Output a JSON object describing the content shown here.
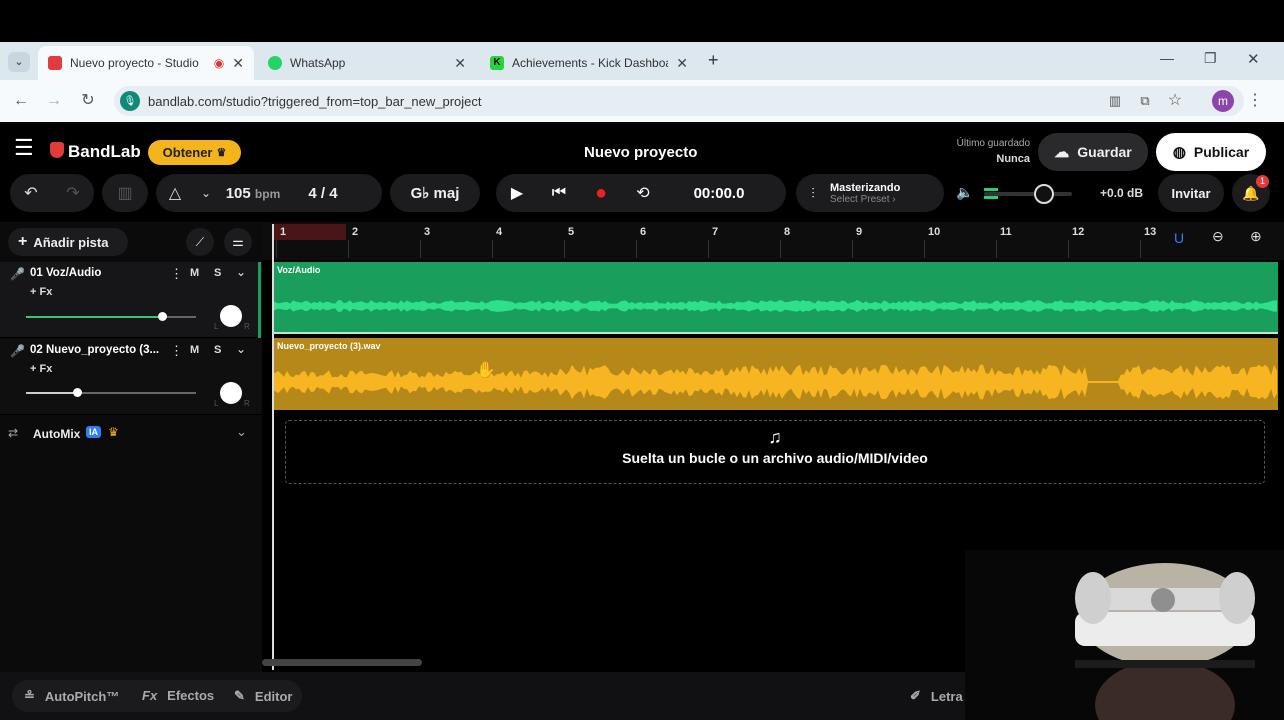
{
  "browser": {
    "tabs": [
      {
        "title": "Nuevo proyecto - Studio",
        "active": true
      },
      {
        "title": "WhatsApp",
        "active": false
      },
      {
        "title": "Achievements - Kick Dashboard",
        "active": false
      }
    ],
    "url": "bandlab.com/studio?triggered_from=top_bar_new_project",
    "profile_initial": "m"
  },
  "app": {
    "brand": "BandLab",
    "get_button": "Obtener",
    "project_title": "Nuevo proyecto",
    "last_saved_label": "Último guardado",
    "last_saved_value": "Nunca",
    "save_button": "Guardar",
    "publish_button": "Publicar"
  },
  "transport": {
    "tempo": "105",
    "tempo_unit": "bpm",
    "time_signature": "4 / 4",
    "key": "G♭ maj",
    "time": "00:00.0",
    "mastering_label": "Masterizando",
    "mastering_preset": "Select Preset ›",
    "volume_db": "+0.0 dB",
    "invite_button": "Invitar",
    "notification_count": "1"
  },
  "tracks_panel": {
    "add_track": "Añadir pista",
    "tracks": [
      {
        "name": "01  Voz/Audio",
        "fx": "+ Fx",
        "mute": "M",
        "solo": "S",
        "volume": 0.8
      },
      {
        "name": "02  Nuevo_proyecto (3...",
        "fx": "+ Fx",
        "mute": "M",
        "solo": "S",
        "volume": 0.3
      }
    ],
    "automix": "AutoMix",
    "automix_badge": "IA"
  },
  "timeline": {
    "ruler": [
      "1",
      "2",
      "3",
      "4",
      "5",
      "6",
      "7",
      "8",
      "9",
      "10",
      "11",
      "12",
      "13"
    ],
    "clips": [
      {
        "label": "Voz/Audio",
        "color": "#1a9e5c"
      },
      {
        "label": "Nuevo_proyecto (3).wav",
        "color": "#b5881a"
      }
    ],
    "dropzone_text": "Suelta un bucle o un archivo audio/MIDI/video"
  },
  "bottom": {
    "autopitch": "AutoPitch™",
    "effects": "Efectos",
    "editor": "Editor",
    "lyrics": "Letra"
  }
}
